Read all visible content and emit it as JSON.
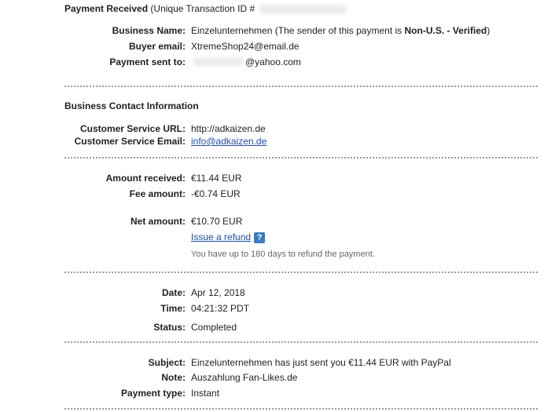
{
  "payment_header": {
    "title": "Payment Received",
    "transaction_label": "(Unique Transaction ID #"
  },
  "business": {
    "name_label": "Business Name:",
    "name_value": "Einzelunternehmen",
    "sender_note_prefix": "(The sender of this payment is",
    "sender_status": "Non-U.S. - Verified",
    "sender_note_suffix": ")",
    "buyer_email_label": "Buyer email:",
    "buyer_email_value": "XtremeShop24@email.de",
    "sent_to_label": "Payment sent to:",
    "sent_to_value": "@yahoo.com"
  },
  "contact": {
    "section_title": "Business Contact Information",
    "url_label": "Customer Service URL:",
    "url_value": "http://adkaizen.de",
    "email_label": "Customer Service Email:",
    "email_value": "info@adkaizen.de"
  },
  "amounts": {
    "received_label": "Amount received:",
    "received_value": "€11.44 EUR",
    "fee_label": "Fee amount:",
    "fee_value": "-€0.74 EUR",
    "net_label": "Net amount:",
    "net_value": "€10.70 EUR",
    "refund_link": "Issue a refund",
    "help_icon": "question-mark",
    "refund_note": "You have up to 180 days to refund the payment."
  },
  "details": {
    "date_label": "Date:",
    "date_value": "Apr 12, 2018",
    "time_label": "Time:",
    "time_value": "04:21:32 PDT",
    "status_label": "Status:",
    "status_value": "Completed"
  },
  "message": {
    "subject_label": "Subject:",
    "subject_value": "Einzelunternehmen has just sent you €11.44 EUR with PayPal",
    "note_label": "Note:",
    "note_value": "Auszahlung Fan-Likes.de",
    "type_label": "Payment type:",
    "type_value": "Instant"
  },
  "colors": {
    "link": "#1f4fa8",
    "help_icon_bg": "#3b7bbf",
    "separator": "#9a9a9a"
  }
}
